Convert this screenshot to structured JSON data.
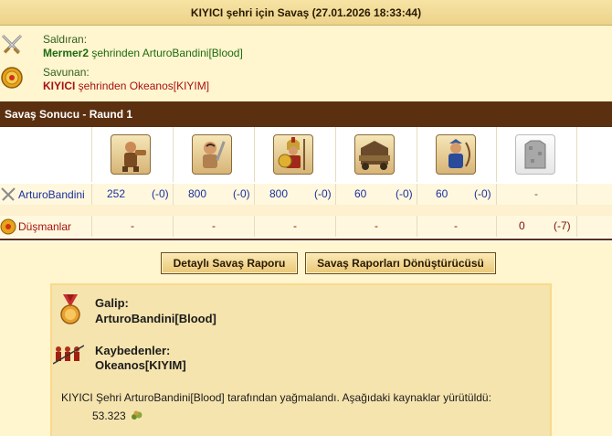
{
  "title": "KIYICI şehri için Savaş (27.01.2026 18:33:44)",
  "attacker": {
    "label": "Saldıran:",
    "city": "Mermer2",
    "connector": " şehrinden ",
    "player": "ArturoBandini[Blood]"
  },
  "defender": {
    "label": "Savunan:",
    "city": "KIYICI",
    "connector": " şehrinden ",
    "player": "Okeanos[KIYIM]"
  },
  "section_title": "Savaş Sonucu - Raund 1",
  "units": [
    {
      "icon": "slinger-unit-icon"
    },
    {
      "icon": "brute-unit-icon"
    },
    {
      "icon": "hoplite-unit-icon"
    },
    {
      "icon": "ram-unit-icon"
    },
    {
      "icon": "archer-unit-icon"
    },
    {
      "icon": "wall-icon"
    }
  ],
  "attacker_row": {
    "name": "ArturoBandini",
    "values": [
      {
        "count": "252",
        "loss": "(-0)"
      },
      {
        "count": "800",
        "loss": "(-0)"
      },
      {
        "count": "800",
        "loss": "(-0)"
      },
      {
        "count": "60",
        "loss": "(-0)"
      },
      {
        "count": "60",
        "loss": "(-0)"
      },
      {
        "count": "-",
        "loss": ""
      }
    ]
  },
  "defender_row": {
    "name": "Düşmanlar",
    "values": [
      {
        "count": "-",
        "loss": ""
      },
      {
        "count": "-",
        "loss": ""
      },
      {
        "count": "-",
        "loss": ""
      },
      {
        "count": "-",
        "loss": ""
      },
      {
        "count": "-",
        "loss": ""
      },
      {
        "count": "0",
        "loss": "(-7)"
      }
    ]
  },
  "buttons": {
    "detailed_report": "Detaylı Savaş Raporu",
    "report_converter": "Savaş Raporları Dönüştürücüsü"
  },
  "result": {
    "winner_title": "Galip:",
    "winner": "ArturoBandini[Blood]",
    "losers_title": "Kaybedenler:",
    "losers": "Okeanos[KIYIM]",
    "loot_text": "KIYICI Şehri ArturoBandini[Blood] tarafından yağmalandı. Aşağıdaki kaynaklar yürütüldü:",
    "loot_amount": "53.323"
  },
  "colors": {
    "header_brown": "#5b3010",
    "attacker_green": "#1d6b10",
    "defender_red": "#a61212",
    "unit_blue": "#1a2fa0"
  }
}
